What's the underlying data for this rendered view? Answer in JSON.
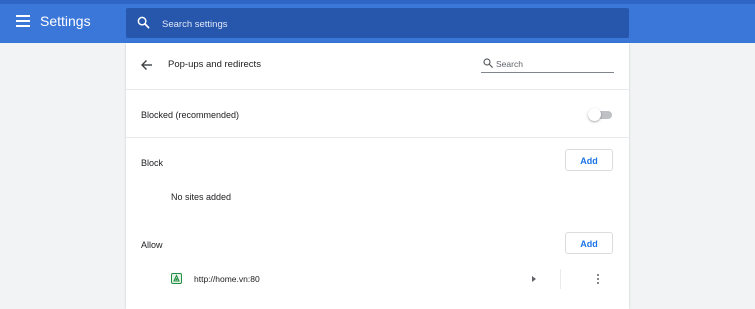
{
  "header": {
    "title": "Settings",
    "search_placeholder": "Search settings"
  },
  "page": {
    "title": "Pop-ups and redirects",
    "search_placeholder": "Search"
  },
  "blocked": {
    "label": "Blocked (recommended)",
    "enabled": false
  },
  "block": {
    "label": "Block",
    "add_label": "Add",
    "empty_text": "No sites added"
  },
  "allow": {
    "label": "Allow",
    "add_label": "Add",
    "sites": [
      {
        "url": "http://home.vn:80"
      }
    ]
  },
  "colors": {
    "header_bg": "#3b77d9",
    "search_bg": "#2757ad",
    "accent": "#1a73e8",
    "page_bg": "#f1f3f4",
    "favicon": "#1e8e3e"
  },
  "icons": {
    "menu": "hamburger-menu-icon",
    "search": "search-icon",
    "back": "arrow-back-icon",
    "favicon": "site-favicon-icon",
    "expand": "arrow-right-icon",
    "more": "more-vertical-icon"
  }
}
